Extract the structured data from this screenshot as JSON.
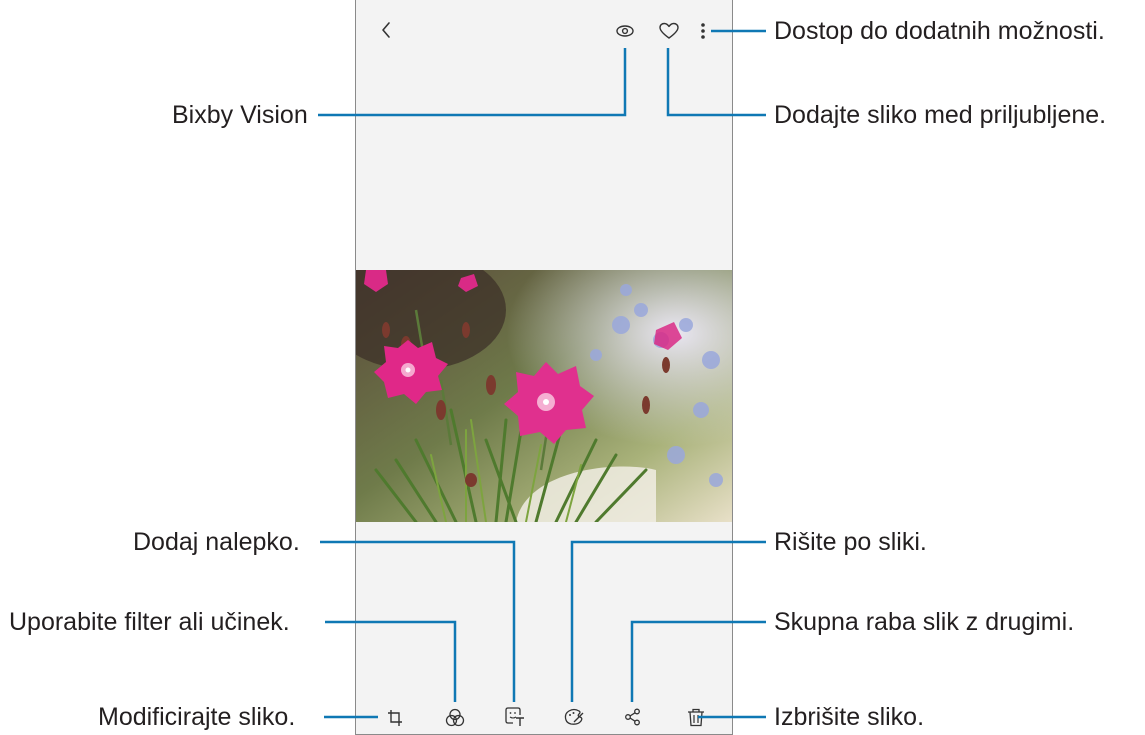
{
  "viewer": {
    "header": {
      "back": "back-icon",
      "bixby": "bixby-vision-icon",
      "favorite": "heart-icon",
      "more": "more-vertical-icon"
    },
    "photo": {
      "subject": "pink-flowers"
    },
    "toolbar": [
      "crop-rotate-icon",
      "filter-icon",
      "sticker-icon",
      "draw-icon",
      "share-icon",
      "trash-icon"
    ]
  },
  "callouts": {
    "more_options": "Dostop do dodatnih možnosti.",
    "bixby_vision": "Bixby Vision",
    "add_favorite": "Dodajte sliko med priljubljene.",
    "add_sticker": "Dodaj nalepko.",
    "draw": "Rišite po sliki.",
    "filter": "Uporabite filter ali učinek.",
    "share": "Skupna raba slik z drugimi.",
    "modify": "Modificirajte sliko.",
    "delete": "Izbrišite sliko."
  },
  "colors": {
    "callout_line": "#0f78b4",
    "text": "#231f20",
    "screen_bg": "#f3f3f3"
  }
}
